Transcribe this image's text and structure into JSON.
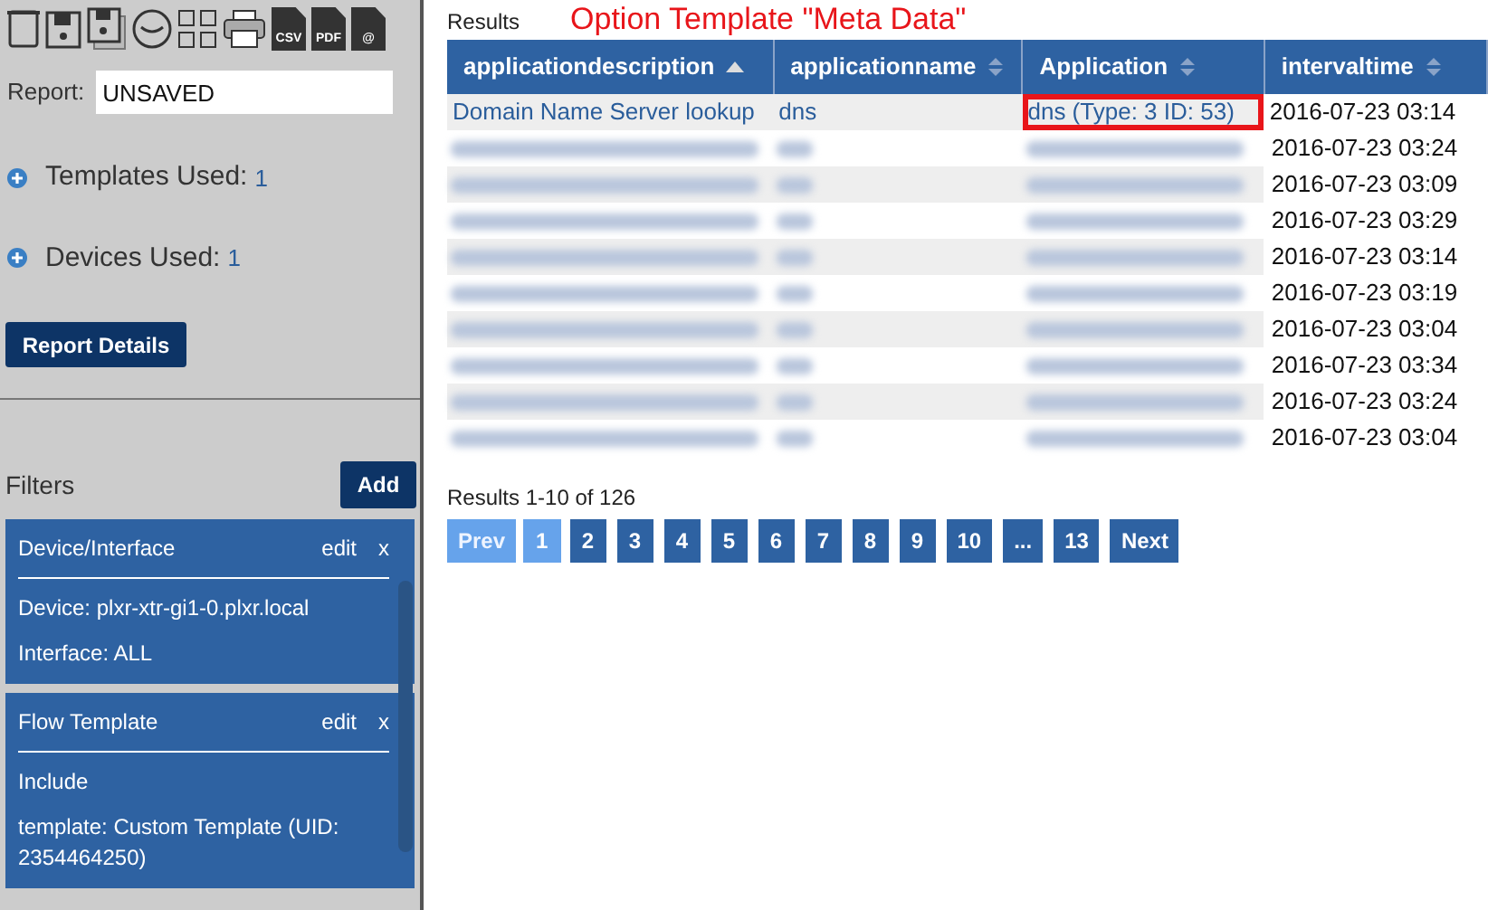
{
  "toolbar": {
    "icons": [
      {
        "kind": "trash"
      },
      {
        "kind": "save"
      },
      {
        "kind": "save-as"
      },
      {
        "kind": "clock"
      },
      {
        "kind": "grid"
      },
      {
        "kind": "print"
      },
      {
        "kind": "file",
        "label": "CSV"
      },
      {
        "kind": "file",
        "label": "PDF"
      },
      {
        "kind": "file",
        "label": "@"
      }
    ]
  },
  "report": {
    "label": "Report:",
    "value": "UNSAVED"
  },
  "summary": [
    {
      "label": "Templates Used:",
      "count": "1"
    },
    {
      "label": "Devices Used:",
      "count": "1"
    }
  ],
  "report_details_button": "Report Details",
  "filters": {
    "title": "Filters",
    "add_button": "Add",
    "items": [
      {
        "title": "Device/Interface",
        "edit": "edit",
        "remove": "x",
        "lines": [
          "Device: plxr-xtr-gi1-0.plxr.local",
          "Interface: ALL"
        ]
      },
      {
        "title": "Flow Template",
        "edit": "edit",
        "remove": "x",
        "lines": [
          "Include",
          "template: Custom Template (UID: 2354464250)"
        ]
      }
    ]
  },
  "results": {
    "title": "Results",
    "annotation": "Option Template \"Meta Data\"",
    "columns": [
      {
        "label": "applicationdescription",
        "sorted": true
      },
      {
        "label": "applicationname",
        "sorted": false
      },
      {
        "label": "Application",
        "sorted": false
      },
      {
        "label": "intervaltime",
        "sorted": false
      }
    ],
    "rows": [
      {
        "blurred": false,
        "cells": [
          {
            "text": "Domain Name Server lookup",
            "highlighted": false
          },
          {
            "text": "dns",
            "highlighted": false
          },
          {
            "text": "dns (Type: 3 ID: 53)",
            "highlighted": true
          },
          {
            "text": "2016-07-23 03:14",
            "highlighted": false
          }
        ]
      },
      {
        "blurred": true,
        "cells": [
          "2016-07-23 03:24"
        ]
      },
      {
        "blurred": true,
        "cells": [
          "2016-07-23 03:09"
        ]
      },
      {
        "blurred": true,
        "cells": [
          "2016-07-23 03:29"
        ]
      },
      {
        "blurred": true,
        "cells": [
          "2016-07-23 03:14"
        ]
      },
      {
        "blurred": true,
        "cells": [
          "2016-07-23 03:19"
        ]
      },
      {
        "blurred": true,
        "cells": [
          "2016-07-23 03:04"
        ]
      },
      {
        "blurred": true,
        "cells": [
          "2016-07-23 03:34"
        ]
      },
      {
        "blurred": true,
        "cells": [
          "2016-07-23 03:24"
        ]
      },
      {
        "blurred": true,
        "cells": [
          "2016-07-23 03:04"
        ]
      }
    ],
    "count": "Results 1-10 of 126",
    "pagination": [
      {
        "label": "Prev",
        "selected": false,
        "disabled": true
      },
      {
        "label": "1",
        "selected": true,
        "disabled": false
      },
      {
        "label": "2",
        "selected": false,
        "disabled": false
      },
      {
        "label": "3",
        "selected": false,
        "disabled": false
      },
      {
        "label": "4",
        "selected": false,
        "disabled": false
      },
      {
        "label": "5",
        "selected": false,
        "disabled": false
      },
      {
        "label": "6",
        "selected": false,
        "disabled": false
      },
      {
        "label": "7",
        "selected": false,
        "disabled": false
      },
      {
        "label": "8",
        "selected": false,
        "disabled": false
      },
      {
        "label": "9",
        "selected": false,
        "disabled": false
      },
      {
        "label": "10",
        "selected": false,
        "disabled": false
      },
      {
        "label": "...",
        "selected": false,
        "disabled": false
      },
      {
        "label": "13",
        "selected": false,
        "disabled": false
      },
      {
        "label": "Next",
        "selected": false,
        "disabled": false
      }
    ]
  }
}
